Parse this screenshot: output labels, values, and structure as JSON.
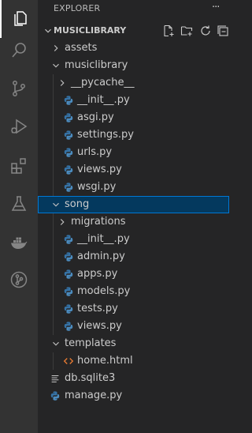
{
  "explorer": {
    "title": "EXPLORER",
    "more": "···",
    "section_title": "MUSICLIBRARY"
  },
  "tree": [
    {
      "label": "assets",
      "type": "folder",
      "expanded": false,
      "depth": 0
    },
    {
      "label": "musiclibrary",
      "type": "folder",
      "expanded": true,
      "depth": 0
    },
    {
      "label": "__pycache__",
      "type": "folder",
      "expanded": false,
      "depth": 1
    },
    {
      "label": "__init__.py",
      "type": "python",
      "depth": 1
    },
    {
      "label": "asgi.py",
      "type": "python",
      "depth": 1
    },
    {
      "label": "settings.py",
      "type": "python",
      "depth": 1
    },
    {
      "label": "urls.py",
      "type": "python",
      "depth": 1
    },
    {
      "label": "views.py",
      "type": "python",
      "depth": 1
    },
    {
      "label": "wsgi.py",
      "type": "python",
      "depth": 1
    },
    {
      "label": "song",
      "type": "folder",
      "expanded": true,
      "depth": 0,
      "selected": true
    },
    {
      "label": "migrations",
      "type": "folder",
      "expanded": false,
      "depth": 1
    },
    {
      "label": "__init__.py",
      "type": "python",
      "depth": 1
    },
    {
      "label": "admin.py",
      "type": "python",
      "depth": 1
    },
    {
      "label": "apps.py",
      "type": "python",
      "depth": 1
    },
    {
      "label": "models.py",
      "type": "python",
      "depth": 1
    },
    {
      "label": "tests.py",
      "type": "python",
      "depth": 1
    },
    {
      "label": "views.py",
      "type": "python",
      "depth": 1
    },
    {
      "label": "templates",
      "type": "folder",
      "expanded": true,
      "depth": 0
    },
    {
      "label": "home.html",
      "type": "html",
      "depth": 1
    },
    {
      "label": "db.sqlite3",
      "type": "text",
      "depth": 0,
      "file_root": true
    },
    {
      "label": "manage.py",
      "type": "python",
      "depth": 0,
      "file_root": true
    }
  ],
  "colors": {
    "activity_bar": "#333333",
    "sidebar": "#252526",
    "selection": "#04395e",
    "selection_border": "#0078d4",
    "python": "#4b8bbe",
    "html": "#e37933",
    "icon": "#858585"
  }
}
